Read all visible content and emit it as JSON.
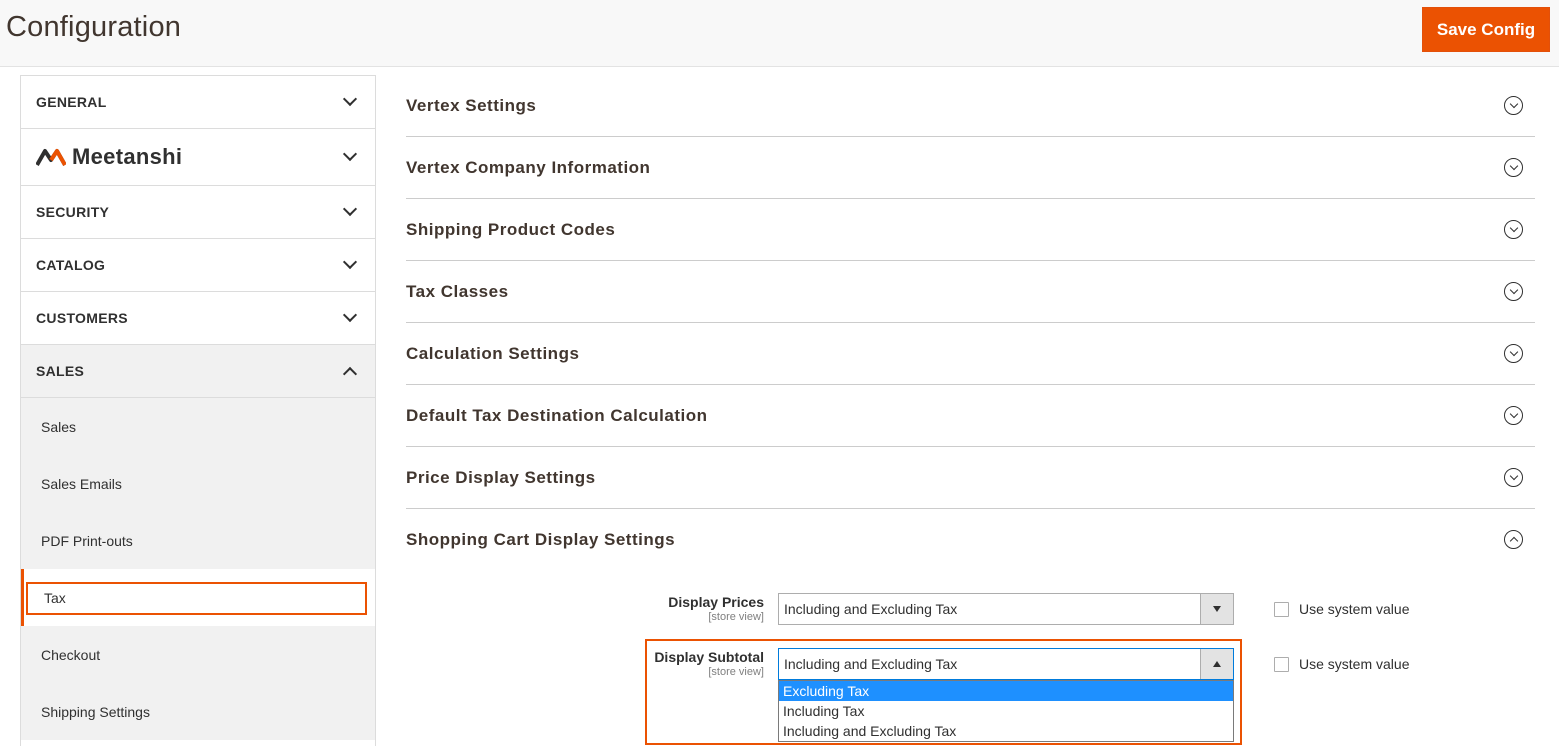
{
  "header": {
    "title": "Configuration",
    "save_label": "Save Config",
    "accent_color": "#eb5202"
  },
  "sidebar": {
    "tabs": [
      {
        "label": "GENERAL",
        "expanded": false
      },
      {
        "label": "Meetanshi",
        "expanded": false,
        "is_brand": true
      },
      {
        "label": "SECURITY",
        "expanded": false
      },
      {
        "label": "CATALOG",
        "expanded": false
      },
      {
        "label": "CUSTOMERS",
        "expanded": false
      },
      {
        "label": "SALES",
        "expanded": true
      }
    ],
    "sales_items": [
      "Sales",
      "Sales Emails",
      "PDF Print-outs",
      "Tax",
      "Checkout",
      "Shipping Settings"
    ],
    "active_item": "Tax"
  },
  "sections": [
    {
      "title": "Vertex Settings",
      "expanded": false
    },
    {
      "title": "Vertex Company Information",
      "expanded": false
    },
    {
      "title": "Shipping Product Codes",
      "expanded": false
    },
    {
      "title": "Tax Classes",
      "expanded": false
    },
    {
      "title": "Calculation Settings",
      "expanded": false
    },
    {
      "title": "Default Tax Destination Calculation",
      "expanded": false
    },
    {
      "title": "Price Display Settings",
      "expanded": false
    },
    {
      "title": "Shopping Cart Display Settings",
      "expanded": true
    }
  ],
  "fields": {
    "display_prices": {
      "label": "Display Prices",
      "scope": "[store view]",
      "value": "Including and Excluding Tax",
      "use_system_label": "Use system value",
      "use_system_checked": false
    },
    "display_subtotal": {
      "label": "Display Subtotal",
      "scope": "[store view]",
      "value": "Including and Excluding Tax",
      "use_system_label": "Use system value",
      "use_system_checked": false,
      "dropdown_open": true,
      "options": [
        "Excluding Tax",
        "Including Tax",
        "Including and Excluding Tax"
      ],
      "highlighted_option": "Excluding Tax"
    }
  },
  "icons": {
    "tab_toggle": "chevron-down-icon",
    "section_toggle": "circle-chevron-icon",
    "select_arrow": "triangle-icon"
  }
}
